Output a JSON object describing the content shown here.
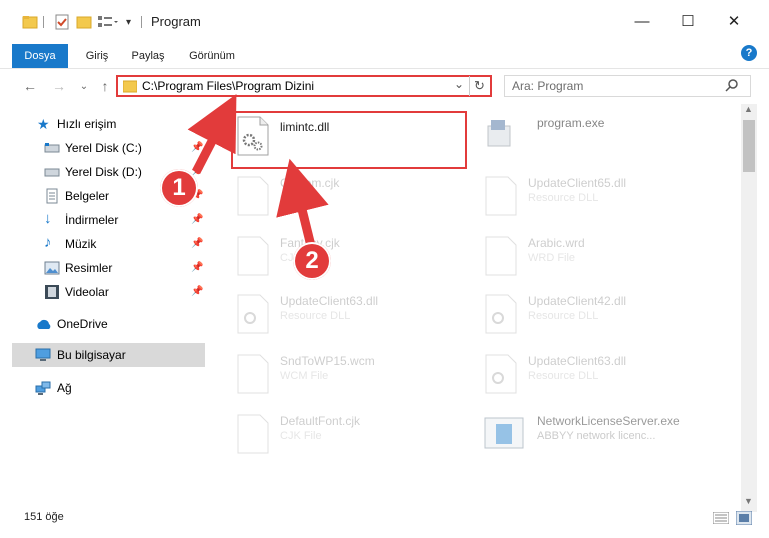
{
  "window": {
    "title": "Program"
  },
  "ribbon": {
    "tabs": [
      "Dosya",
      "Giriş",
      "Paylaş",
      "Görünüm"
    ]
  },
  "address": {
    "path": "C:\\Program Files\\Program Dizini"
  },
  "search": {
    "placeholder": "Ara: Program"
  },
  "sidebar": {
    "items": [
      {
        "label": "Hızlı erişim",
        "icon": "star-icon"
      },
      {
        "label": "Yerel Disk (C:)",
        "icon": "drive-icon"
      },
      {
        "label": "Yerel Disk (D:)",
        "icon": "drive-icon"
      },
      {
        "label": "Belgeler",
        "icon": "documents-icon"
      },
      {
        "label": "İndirmeler",
        "icon": "download-icon"
      },
      {
        "label": "Müzik",
        "icon": "music-icon"
      },
      {
        "label": "Resimler",
        "icon": "pictures-icon"
      },
      {
        "label": "Videolar",
        "icon": "video-icon"
      },
      {
        "label": "OneDrive",
        "icon": "cloud-icon"
      },
      {
        "label": "Bu bilgisayar",
        "icon": "computer-icon"
      },
      {
        "label": "Ağ",
        "icon": "network-icon"
      }
    ]
  },
  "files": [
    {
      "name": "limintc.dll",
      "type": ""
    },
    {
      "name": "program.exe",
      "type": ""
    },
    {
      "name": "Custom.cjk",
      "type": "CJK File"
    },
    {
      "name": "UpdateClient65.dll",
      "type": "Resource DLL"
    },
    {
      "name": "Fantasy.cjk",
      "type": "CJK File"
    },
    {
      "name": "Arabic.wrd",
      "type": "WRD File"
    },
    {
      "name": "UpdateClient63.dll",
      "type": "Resource DLL"
    },
    {
      "name": "UpdateClient42.dll",
      "type": "Resource DLL"
    },
    {
      "name": "SndToWP15.wcm",
      "type": "WCM File"
    },
    {
      "name": "UpdateClient63.dll",
      "type": "Resource DLL"
    },
    {
      "name": "DefaultFont.cjk",
      "type": "CJK File"
    },
    {
      "name": "NetworkLicenseServer.exe",
      "type": "ABBYY network licenc..."
    }
  ],
  "status": {
    "count": "151 öğe"
  },
  "annotations": {
    "step1": "1",
    "step2": "2"
  },
  "colors": {
    "accent": "#1979ca",
    "highlight": "#e23b3b"
  }
}
